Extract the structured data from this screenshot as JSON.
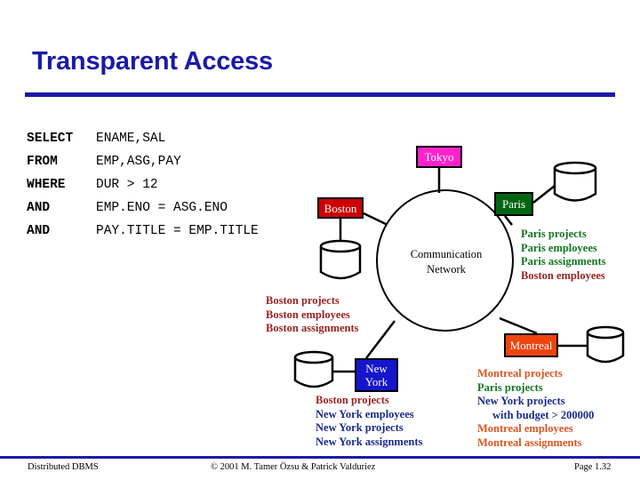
{
  "slide": {
    "title": "Transparent Access"
  },
  "sql": {
    "rows": [
      {
        "keyword": "SELECT",
        "body": "ENAME,SAL"
      },
      {
        "keyword": "FROM",
        "body": "EMP,ASG,PAY"
      },
      {
        "keyword": "WHERE",
        "body": "DUR > 12"
      },
      {
        "keyword": "AND",
        "body": "EMP.ENO = ASG.ENO"
      },
      {
        "keyword": "AND",
        "body": "PAY.TITLE = EMP.TITLE"
      }
    ]
  },
  "network": {
    "label_line1": "Communication",
    "label_line2": "Network",
    "sites": [
      {
        "name": "Tokyo",
        "label": "Tokyo",
        "color": "#ff22cc",
        "text_color": "#ffffff"
      },
      {
        "name": "Boston",
        "label": "Boston",
        "color": "#cc0000",
        "text_color": "#ffffff"
      },
      {
        "name": "Paris",
        "label": "Paris",
        "color": "#006611",
        "text_color": "#ffffff"
      },
      {
        "name": "New York",
        "label": "New\nYork",
        "color": "#1515cc",
        "text_color": "#ffffff"
      },
      {
        "name": "Montreal",
        "label": "Montreal",
        "color": "#ee4410",
        "text_color": "#ffffff"
      }
    ]
  },
  "fragments": {
    "colors": {
      "boston": "#992222",
      "paris": "#117722",
      "newyork": "#1a2a8a",
      "montreal": "#dd5522"
    },
    "boston": [
      {
        "text": "Boston projects",
        "color": "#992222",
        "indent": false
      },
      {
        "text": "Boston employees",
        "color": "#992222",
        "indent": false
      },
      {
        "text": "Boston assignments",
        "color": "#992222",
        "indent": false
      }
    ],
    "paris": [
      {
        "text": "Paris projects",
        "color": "#117722",
        "indent": false
      },
      {
        "text": "Paris employees",
        "color": "#117722",
        "indent": false
      },
      {
        "text": "Paris assignments",
        "color": "#117722",
        "indent": false
      },
      {
        "text": "Boston employees",
        "color": "#992222",
        "indent": false
      }
    ],
    "newyork": [
      {
        "text": "Boston projects",
        "color": "#992222",
        "indent": false
      },
      {
        "text": "New York employees",
        "color": "#1a2a8a",
        "indent": false
      },
      {
        "text": "New York projects",
        "color": "#1a2a8a",
        "indent": false
      },
      {
        "text": "New York assignments",
        "color": "#1a2a8a",
        "indent": false
      }
    ],
    "montreal": [
      {
        "text": "Montreal projects",
        "color": "#dd5522",
        "indent": false
      },
      {
        "text": "Paris projects",
        "color": "#117722",
        "indent": false
      },
      {
        "text": "New York projects",
        "color": "#1a2a8a",
        "indent": false
      },
      {
        "text": "with budget > 200000",
        "color": "#1a2a8a",
        "indent": true
      },
      {
        "text": "Montreal employees",
        "color": "#dd5522",
        "indent": false
      },
      {
        "text": "Montreal assignments",
        "color": "#dd5522",
        "indent": false
      }
    ]
  },
  "footer": {
    "left": "Distributed DBMS",
    "center": "© 2001 M. Tamer Özsu & Patrick Valduriez",
    "right": "Page 1.32"
  }
}
